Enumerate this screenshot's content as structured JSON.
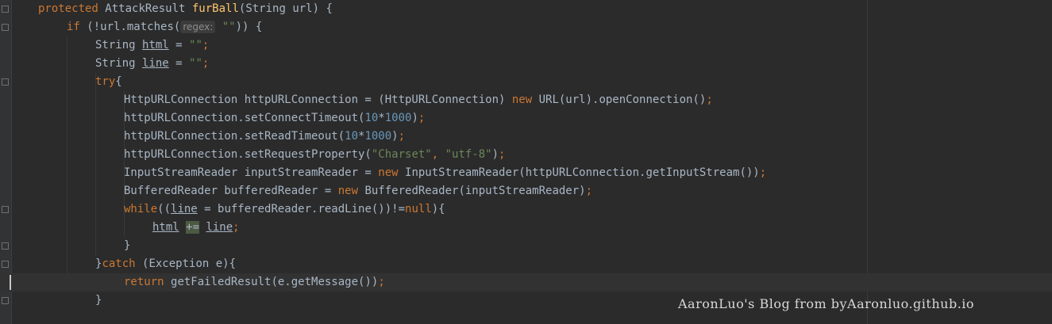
{
  "editor": {
    "lines": [
      {
        "indent": 0,
        "tokens": [
          {
            "t": "protected ",
            "c": "kw"
          },
          {
            "t": "AttackResult ",
            "c": ""
          },
          {
            "t": "furBall",
            "c": "fn"
          },
          {
            "t": "(String url) {",
            "c": ""
          }
        ]
      },
      {
        "indent": 1,
        "tokens": [
          {
            "t": "if ",
            "c": "kw"
          },
          {
            "t": "(!url.matches(",
            "c": ""
          },
          {
            "t": "regex:",
            "c": "hint"
          },
          {
            "t": " ",
            "c": ""
          },
          {
            "t": "\"\"",
            "c": "str"
          },
          {
            "t": ")) {",
            "c": ""
          }
        ]
      },
      {
        "indent": 2,
        "tokens": [
          {
            "t": "String ",
            "c": ""
          },
          {
            "t": "html",
            "c": "u"
          },
          {
            "t": " = ",
            "c": ""
          },
          {
            "t": "\"\"",
            "c": "str"
          },
          {
            "t": ";",
            "c": "kw"
          }
        ]
      },
      {
        "indent": 2,
        "tokens": [
          {
            "t": "String ",
            "c": ""
          },
          {
            "t": "line",
            "c": "u"
          },
          {
            "t": " = ",
            "c": ""
          },
          {
            "t": "\"\"",
            "c": "str"
          },
          {
            "t": ";",
            "c": "kw"
          }
        ]
      },
      {
        "indent": 2,
        "tokens": [
          {
            "t": "try",
            "c": "kw"
          },
          {
            "t": "{",
            "c": ""
          }
        ]
      },
      {
        "indent": 3,
        "tokens": [
          {
            "t": "HttpURLConnection httpURLConnection = (HttpURLConnection) ",
            "c": ""
          },
          {
            "t": "new ",
            "c": "kw"
          },
          {
            "t": "URL(url).openConnection()",
            "c": ""
          },
          {
            "t": ";",
            "c": "kw"
          }
        ]
      },
      {
        "indent": 3,
        "tokens": [
          {
            "t": "httpURLConnection.setConnectTimeout(",
            "c": ""
          },
          {
            "t": "10",
            "c": "num"
          },
          {
            "t": "*",
            "c": ""
          },
          {
            "t": "1000",
            "c": "num"
          },
          {
            "t": ")",
            "c": ""
          },
          {
            "t": ";",
            "c": "kw"
          }
        ]
      },
      {
        "indent": 3,
        "tokens": [
          {
            "t": "httpURLConnection.setReadTimeout(",
            "c": ""
          },
          {
            "t": "10",
            "c": "num"
          },
          {
            "t": "*",
            "c": ""
          },
          {
            "t": "1000",
            "c": "num"
          },
          {
            "t": ")",
            "c": ""
          },
          {
            "t": ";",
            "c": "kw"
          }
        ]
      },
      {
        "indent": 3,
        "tokens": [
          {
            "t": "httpURLConnection.setRequestProperty(",
            "c": ""
          },
          {
            "t": "\"Charset\"",
            "c": "str"
          },
          {
            "t": ", ",
            "c": "kw"
          },
          {
            "t": "\"utf-8\"",
            "c": "str"
          },
          {
            "t": ")",
            "c": ""
          },
          {
            "t": ";",
            "c": "kw"
          }
        ]
      },
      {
        "indent": 3,
        "tokens": [
          {
            "t": "InputStreamReader inputStreamReader = ",
            "c": ""
          },
          {
            "t": "new ",
            "c": "kw"
          },
          {
            "t": "InputStreamReader(httpURLConnection.getInputStream())",
            "c": ""
          },
          {
            "t": ";",
            "c": "kw"
          }
        ]
      },
      {
        "indent": 3,
        "tokens": [
          {
            "t": "BufferedReader bufferedReader = ",
            "c": ""
          },
          {
            "t": "new ",
            "c": "kw"
          },
          {
            "t": "BufferedReader(inputStreamReader)",
            "c": ""
          },
          {
            "t": ";",
            "c": "kw"
          }
        ]
      },
      {
        "indent": 3,
        "tokens": [
          {
            "t": "while",
            "c": "kw"
          },
          {
            "t": "((",
            "c": ""
          },
          {
            "t": "line",
            "c": "u"
          },
          {
            "t": " = bufferedReader.readLine())!=",
            "c": ""
          },
          {
            "t": "null",
            "c": "kw"
          },
          {
            "t": "){",
            "c": ""
          }
        ]
      },
      {
        "indent": 4,
        "tokens": [
          {
            "t": "html",
            "c": "u"
          },
          {
            "t": " ",
            "c": ""
          },
          {
            "t": "+=",
            "c": "op-hl"
          },
          {
            "t": " ",
            "c": ""
          },
          {
            "t": "line",
            "c": "u"
          },
          {
            "t": ";",
            "c": "kw"
          }
        ]
      },
      {
        "indent": 3,
        "tokens": [
          {
            "t": "}",
            "c": ""
          }
        ]
      },
      {
        "indent": 2,
        "tokens": [
          {
            "t": "}",
            "c": ""
          },
          {
            "t": "catch ",
            "c": "kw"
          },
          {
            "t": "(Exception e){",
            "c": ""
          }
        ]
      },
      {
        "indent": 3,
        "current": true,
        "tokens": [
          {
            "t": "return ",
            "c": "kw"
          },
          {
            "t": "getFailedResult(e.getMessage())",
            "c": ""
          },
          {
            "t": ";",
            "c": "kw"
          }
        ]
      },
      {
        "indent": 2,
        "tokens": [
          {
            "t": "}",
            "c": ""
          }
        ]
      }
    ]
  },
  "watermark": "AaronLuo's Blog from byAaronluo.github.io"
}
